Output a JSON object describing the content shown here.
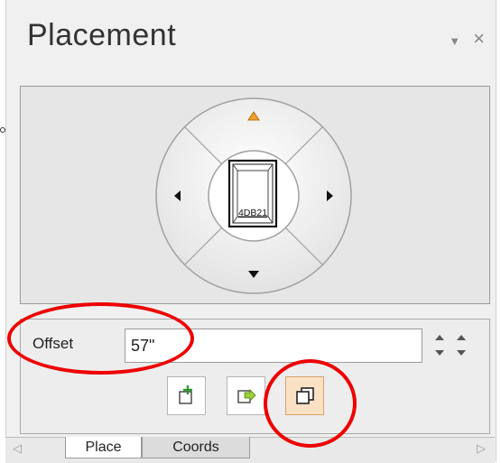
{
  "panel": {
    "title": "Placement",
    "dropdown_icon": "▼",
    "close_icon": "×"
  },
  "wheel": {
    "center_label": "4DB21",
    "up_arrow_color": "#f0a030"
  },
  "offset": {
    "label": "Offset",
    "value": "57\""
  },
  "tabs": [
    {
      "label": "Place",
      "active": true
    },
    {
      "label": "Coords",
      "active": false
    }
  ],
  "colors": {
    "annotation": "#ee0000",
    "selected_button": "#fbe1c4"
  }
}
